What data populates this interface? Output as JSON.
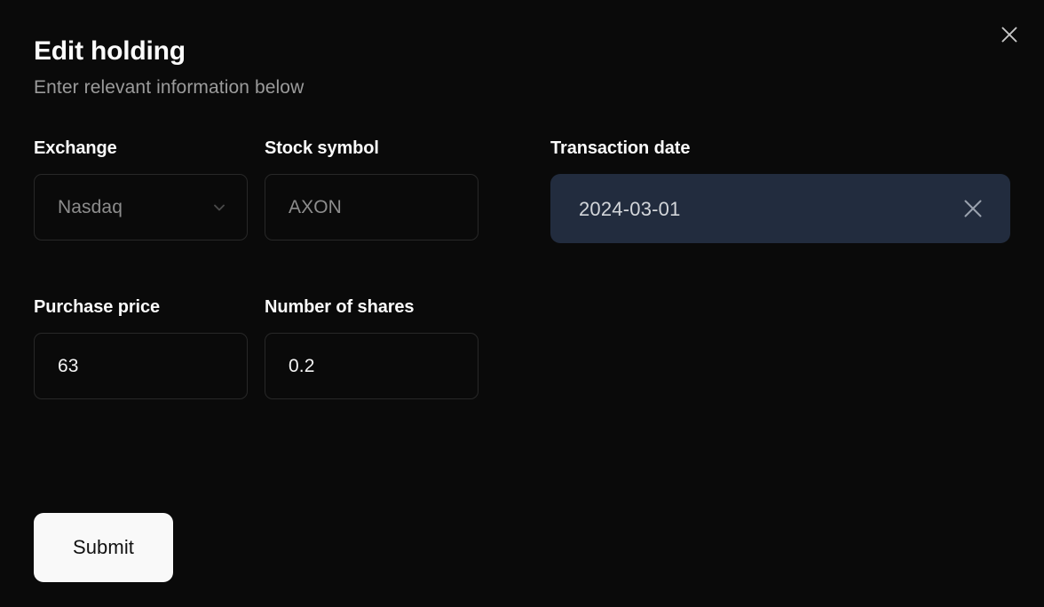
{
  "modal": {
    "title": "Edit holding",
    "subtitle": "Enter relevant information below",
    "close_icon": "close-icon"
  },
  "fields": {
    "exchange": {
      "label": "Exchange",
      "value": "Nasdaq",
      "is_placeholder": true,
      "icon": "chevron-down-icon",
      "options": [
        "Nasdaq"
      ]
    },
    "stock_symbol": {
      "label": "Stock symbol",
      "value": "",
      "placeholder": "AXON",
      "display": "AXON",
      "is_placeholder": true
    },
    "transaction_date": {
      "label": "Transaction date",
      "value": "2024-03-01",
      "clear_icon": "close-icon",
      "highlighted": true
    },
    "purchase_price": {
      "label": "Purchase price",
      "value": "63",
      "is_placeholder": false
    },
    "number_of_shares": {
      "label": "Number of shares",
      "value": "0.2",
      "is_placeholder": false
    }
  },
  "actions": {
    "submit_label": "Submit"
  },
  "colors": {
    "background": "#0a0a0a",
    "surface_border": "#282828",
    "date_field_bg": "#222c3e",
    "text_primary": "#fbfbfb",
    "text_muted": "#9b9b9b",
    "placeholder": "#8d8d8d",
    "submit_bg": "#f9f9f9",
    "submit_text": "#111111"
  }
}
